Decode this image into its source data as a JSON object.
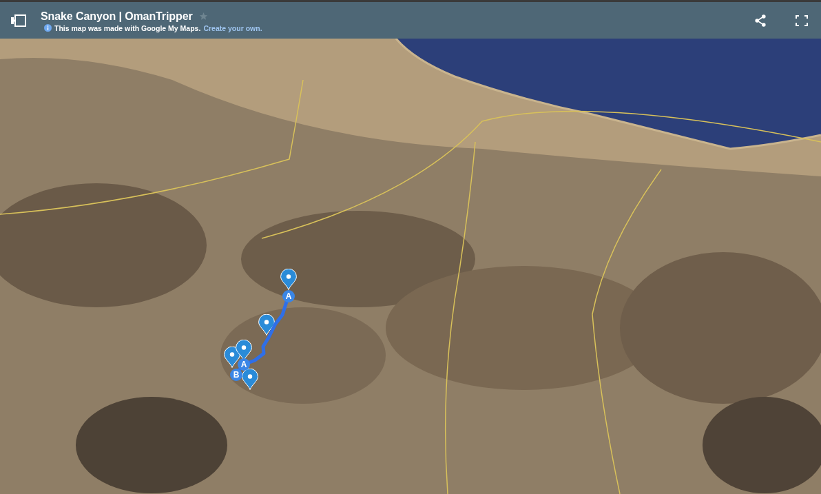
{
  "header": {
    "title": "Snake Canyon | OmanTripper",
    "starred": false,
    "notice": "This map was made with Google My Maps.",
    "link": "Create your own."
  },
  "map": {
    "route_markers": [
      {
        "label": "A"
      },
      {
        "label": "A"
      },
      {
        "label": "B"
      }
    ]
  }
}
